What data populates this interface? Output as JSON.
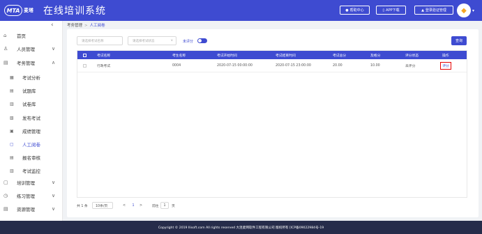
{
  "header": {
    "logo_badge": "MTA",
    "logo_cn": "麦塔",
    "title": "在线培训系统",
    "help_label": "帮助中心",
    "app_label": "APP下载",
    "login_label": "登录验证管理",
    "colors": {
      "primary": "#3e4bd1",
      "footer": "#262c4a",
      "highlight": "#e60000"
    }
  },
  "sidebar": {
    "items": [
      {
        "label": "首页",
        "icon": "home-icon"
      },
      {
        "label": "人员管理",
        "icon": "user-icon",
        "caret": "∨"
      },
      {
        "label": "考务管理",
        "icon": "exam-icon",
        "caret": "∧"
      },
      {
        "label": "考试分析",
        "icon": "analysis-icon"
      },
      {
        "label": "试题库",
        "icon": "question-bank-icon"
      },
      {
        "label": "试卷库",
        "icon": "paper-bank-icon"
      },
      {
        "label": "发布考试",
        "icon": "publish-icon"
      },
      {
        "label": "成绩管理",
        "icon": "score-icon"
      },
      {
        "label": "人工阅卷",
        "icon": "grading-icon"
      },
      {
        "label": "报名审核",
        "icon": "review-icon"
      },
      {
        "label": "考试监控",
        "icon": "monitor-icon"
      },
      {
        "label": "培训管理",
        "icon": "training-icon",
        "caret": "∨"
      },
      {
        "label": "练习管理",
        "icon": "practice-icon",
        "caret": "∨"
      },
      {
        "label": "资源管理",
        "icon": "resource-icon",
        "caret": "∨"
      }
    ]
  },
  "breadcrumb": {
    "parent": "考务管理",
    "separator": ">",
    "current": "人工阅卷"
  },
  "filters": {
    "exam_name_placeholder": "请选择考试名称",
    "status_placeholder": "请选择考试状态",
    "toggle_label": "未评分",
    "search_label": "查询"
  },
  "table": {
    "columns": [
      "考试名称",
      "考生名称",
      "考试开始时间",
      "考试结束时间",
      "考试总分",
      "及格分",
      "评分状态",
      "操作"
    ],
    "rows": [
      {
        "exam_name": "行政考试",
        "candidate": "0004",
        "start": "2020-07-15 00:00:00",
        "end": "2020-07-15 23:00:00",
        "total": "20.00",
        "pass": "10.00",
        "status": "未评分",
        "action": "评分"
      }
    ]
  },
  "pagination": {
    "total_text": "共 1 条",
    "page_size": "10条/页",
    "prev": "<",
    "current_page": "1",
    "next": ">",
    "goto_label": "前往",
    "goto_value": "1",
    "page_suffix": "页"
  },
  "footer": {
    "text": "Copyright © 2019 Ilisoft.com All rights reserved 大连麦网软件工程有限公司 版权所有 [ICP备09022984号-19"
  }
}
